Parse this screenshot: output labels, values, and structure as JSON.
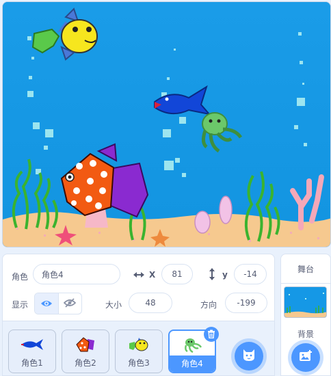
{
  "sprite_info": {
    "sprite_label": "角色",
    "sprite_name": "角色4",
    "x_label": "X",
    "x_value": "81",
    "y_label": "y",
    "y_value": "-14",
    "show_label": "显示",
    "size_label": "大小",
    "size_value": "48",
    "direction_label": "方向",
    "direction_value": "-199"
  },
  "sprites": [
    {
      "label": "角色1",
      "icon": "blue-fish-icon",
      "selected": false
    },
    {
      "label": "角色2",
      "icon": "orange-fish-icon",
      "selected": false
    },
    {
      "label": "角色3",
      "icon": "yellow-fish-icon",
      "selected": false
    },
    {
      "label": "角色4",
      "icon": "octopus-icon",
      "selected": true
    }
  ],
  "stage_panel": {
    "title": "舞台",
    "backdrop_label": "背景"
  },
  "colors": {
    "accent": "#4c97ff",
    "water": "#1598e6",
    "sand": "#f6c98f",
    "text": "#575e75"
  }
}
